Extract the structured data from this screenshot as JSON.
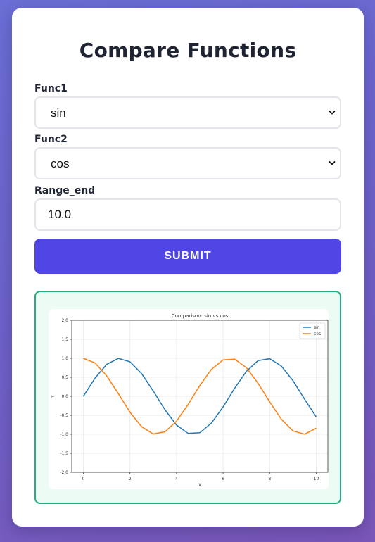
{
  "form": {
    "title": "Compare Functions",
    "func1_label": "Func1",
    "func1_value": "sin",
    "func2_label": "Func2",
    "func2_value": "cos",
    "range_label": "Range_end",
    "range_value": "10.0",
    "submit_label": "SUBMIT"
  },
  "colors": {
    "accent": "#4f46e5",
    "result_border": "#22b07d",
    "sin": "#1f77b4",
    "cos": "#ff7f0e"
  },
  "icons": [
    "chevron-down-icon"
  ],
  "chart_data": {
    "type": "line",
    "title": "Comparison: sin vs cos",
    "xlabel": "X",
    "ylabel": "Y",
    "xlim": [
      -0.5,
      10.5
    ],
    "ylim": [
      -2.0,
      2.0
    ],
    "xticks": [
      "0",
      "2",
      "4",
      "6",
      "8",
      "10"
    ],
    "yticks": [
      "-2.0",
      "-1.5",
      "-1.0",
      "-0.5",
      "0.0",
      "0.5",
      "1.0",
      "1.5",
      "2.0"
    ],
    "grid": true,
    "legend": "top-right",
    "x": [
      0,
      0.5,
      1,
      1.5,
      2,
      2.5,
      3,
      3.5,
      4,
      4.5,
      5,
      5.5,
      6,
      6.5,
      7,
      7.5,
      8,
      8.5,
      9,
      9.5,
      10
    ],
    "series": [
      {
        "name": "sin",
        "values": [
          0,
          0.479,
          0.841,
          0.997,
          0.909,
          0.598,
          0.141,
          -0.351,
          -0.757,
          -0.978,
          -0.959,
          -0.706,
          -0.279,
          0.215,
          0.657,
          0.938,
          0.989,
          0.798,
          0.412,
          -0.075,
          -0.544
        ]
      },
      {
        "name": "cos",
        "values": [
          1,
          0.878,
          0.54,
          0.071,
          -0.416,
          -0.801,
          -0.99,
          -0.936,
          -0.654,
          -0.211,
          0.284,
          0.709,
          0.96,
          0.977,
          0.754,
          0.347,
          -0.146,
          -0.602,
          -0.911,
          -0.997,
          -0.839
        ]
      }
    ]
  }
}
